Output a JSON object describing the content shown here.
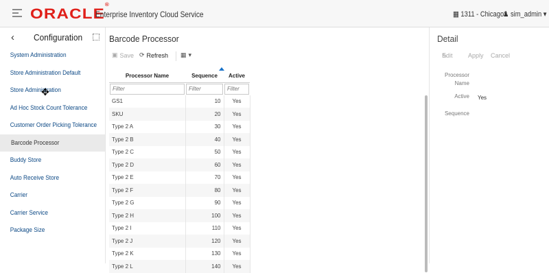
{
  "header": {
    "logo": "ORACLE",
    "app_name": "Enterprise Inventory Cloud Service",
    "store": "1311 - Chicago*",
    "user": "sim_admin"
  },
  "left_panel": {
    "title": "Configuration",
    "items": [
      "System Administration",
      "Store Administration Default",
      "Store Administration",
      "Ad Hoc Stock Count Tolerance",
      "Customer Order Picking Tolerance",
      "Barcode Processor",
      "Buddy Store",
      "Auto Receive Store",
      "Carrier",
      "Carrier Service",
      "Package Size"
    ],
    "selected": "Barcode Processor"
  },
  "main": {
    "title": "Barcode Processor",
    "toolbar": {
      "save": "Save",
      "refresh": "Refresh"
    },
    "columns": [
      "Processor Name",
      "Sequence",
      "Active"
    ],
    "filter_placeholder": "Filter",
    "rows": [
      {
        "name": "GS1",
        "sequence": "10",
        "active": "Yes"
      },
      {
        "name": "SKU",
        "sequence": "20",
        "active": "Yes"
      },
      {
        "name": "Type 2 A",
        "sequence": "30",
        "active": "Yes"
      },
      {
        "name": "Type 2 B",
        "sequence": "40",
        "active": "Yes"
      },
      {
        "name": "Type 2 C",
        "sequence": "50",
        "active": "Yes"
      },
      {
        "name": "Type 2 D",
        "sequence": "60",
        "active": "Yes"
      },
      {
        "name": "Type 2 E",
        "sequence": "70",
        "active": "Yes"
      },
      {
        "name": "Type 2 F",
        "sequence": "80",
        "active": "Yes"
      },
      {
        "name": "Type 2 G",
        "sequence": "90",
        "active": "Yes"
      },
      {
        "name": "Type 2 H",
        "sequence": "100",
        "active": "Yes"
      },
      {
        "name": "Type 2 I",
        "sequence": "110",
        "active": "Yes"
      },
      {
        "name": "Type 2 J",
        "sequence": "120",
        "active": "Yes"
      },
      {
        "name": "Type 2 K",
        "sequence": "130",
        "active": "Yes"
      },
      {
        "name": "Type 2 L",
        "sequence": "140",
        "active": "Yes"
      }
    ]
  },
  "detail": {
    "title": "Detail",
    "edit": "Edit",
    "apply": "Apply",
    "cancel": "Cancel",
    "processor_label_1": "Processor",
    "processor_label_2": "Name",
    "active_label": "Active",
    "active_value": "Yes",
    "sequence_label": "Sequence"
  }
}
